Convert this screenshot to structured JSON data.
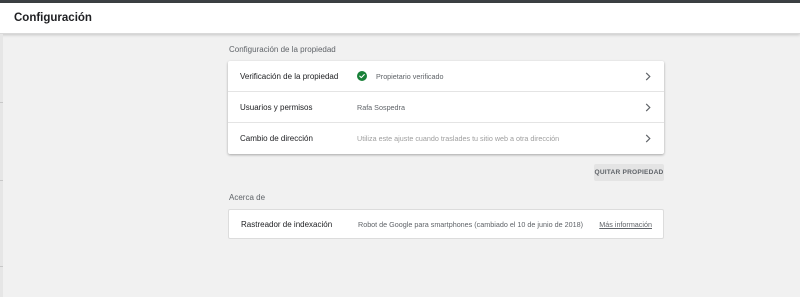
{
  "header": {
    "title": "Configuración"
  },
  "property_section": {
    "title": "Configuración de la propiedad",
    "rows": [
      {
        "label": "Verificación de la propiedad",
        "value": "Propietario verificado",
        "icon": "check-circle-icon",
        "icon_color": "#188038"
      },
      {
        "label": "Usuarios y permisos",
        "value": "Rafa Sospedra"
      },
      {
        "label": "Cambio de dirección",
        "value": "Utiliza este ajuste cuando traslades tu sitio web a otra dirección"
      }
    ]
  },
  "remove_button": {
    "label": "QUITAR PROPIEDAD"
  },
  "about_section": {
    "title": "Acerca de",
    "label": "Rastreador de indexación",
    "value": "Robot de Google para smartphones (cambiado el 10 de junio de 2018)",
    "link": "Más información"
  }
}
